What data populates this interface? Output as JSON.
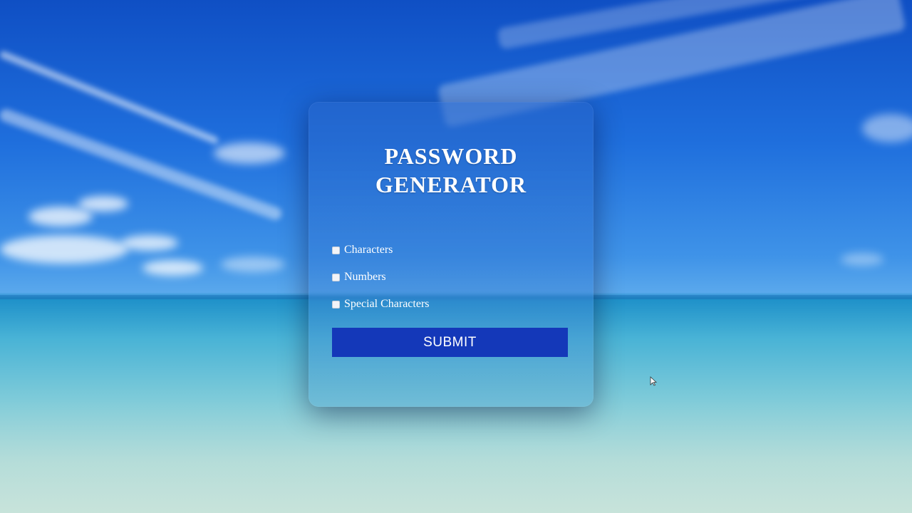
{
  "app": {
    "title_line1": "PASSWORD",
    "title_line2": "GENERATOR"
  },
  "options": [
    {
      "label": "Characters",
      "checked": false
    },
    {
      "label": "Numbers",
      "checked": false
    },
    {
      "label": "Special Characters",
      "checked": false
    }
  ],
  "submit_label": "SUBMIT",
  "colors": {
    "button": "#1438b9",
    "text": "#ffffff"
  },
  "icons": {
    "pointer": "mouse-pointer-icon"
  }
}
